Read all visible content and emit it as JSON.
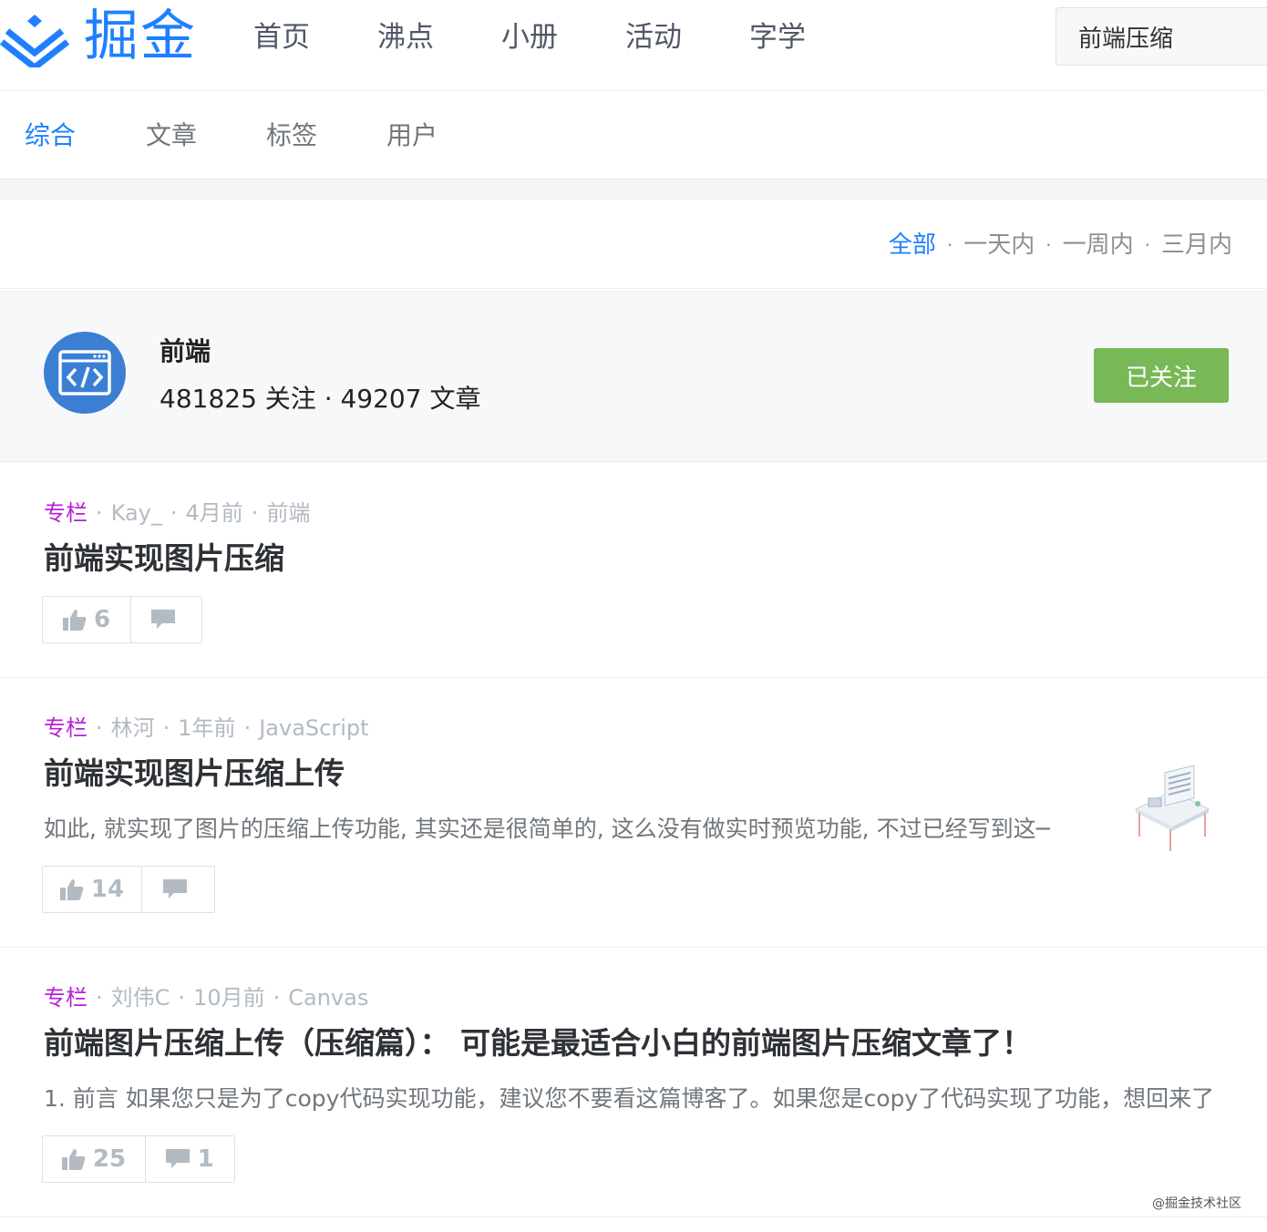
{
  "header": {
    "logo_text": "掘金",
    "nav": [
      "首页",
      "沸点",
      "小册",
      "活动",
      "字学"
    ],
    "search_value": "前端压缩"
  },
  "sub_tabs": [
    "综合",
    "文章",
    "标签",
    "用户"
  ],
  "time_filter": [
    "全部",
    "一天内",
    "一周内",
    "三月内"
  ],
  "tag": {
    "name": "前端",
    "stats": "481825 关注 · 49207 文章",
    "follow_label": "已关注"
  },
  "articles": [
    {
      "category": "专栏",
      "author": "Kay_",
      "time": "4月前",
      "tag": "前端",
      "title": "前端实现图片压缩",
      "abstract": "",
      "likes": "6",
      "comments": ""
    },
    {
      "category": "专栏",
      "author": "林河",
      "time": "1年前",
      "tag": "JavaScript",
      "title": "前端实现图片压缩上传",
      "abstract": "如此, 就实现了图片的压缩上传功能, 其实还是很简单的, 这么没有做实时预览功能, 不过已经写到这─",
      "likes": "14",
      "comments": ""
    },
    {
      "category": "专栏",
      "author": "刘伟C",
      "time": "10月前",
      "tag": "Canvas",
      "title": "前端图片压缩上传（压缩篇）： 可能是最适合小白的前端图片压缩文章了！",
      "abstract": "1. 前言 如果您只是为了copy代码实现功能，建议您不要看这篇博客了。如果您是copy了代码实现了功能，想回来了",
      "likes": "25",
      "comments": "1"
    }
  ],
  "watermark": "@掘金技术社区",
  "colors": {
    "brand": "#1e80ff",
    "category": "#b71ed7",
    "follow": "#78b856"
  }
}
